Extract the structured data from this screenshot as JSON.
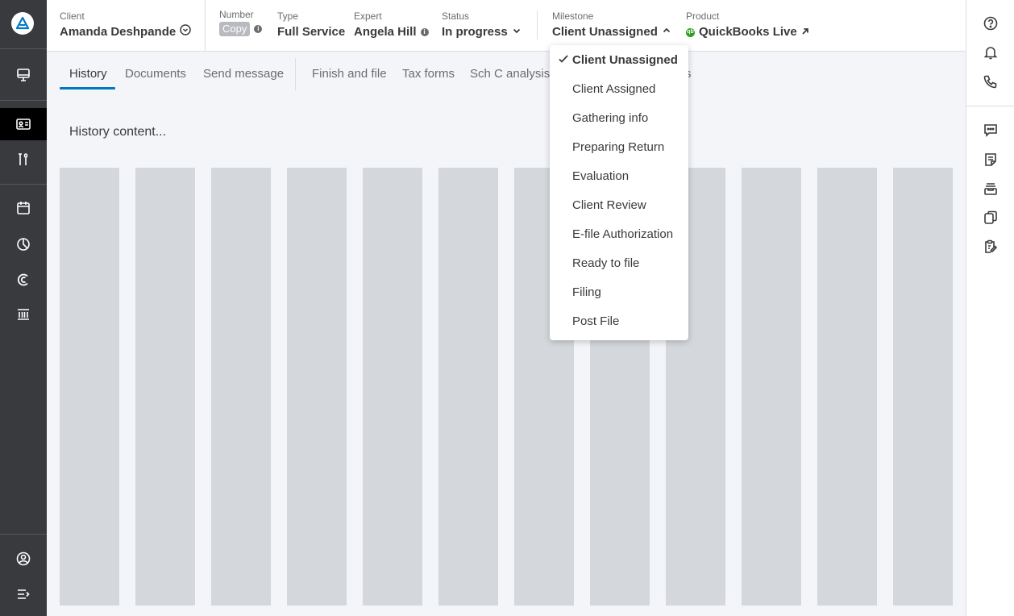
{
  "header": {
    "client": {
      "label": "Client",
      "value": "Amanda Deshpande"
    },
    "number": {
      "label": "Number",
      "copy_label": "Copy"
    },
    "type": {
      "label": "Type",
      "value": "Full Service"
    },
    "expert": {
      "label": "Expert",
      "value": "Angela Hill"
    },
    "status": {
      "label": "Status",
      "value": "In progress"
    },
    "milestone": {
      "label": "Milestone",
      "value": "Client Unassigned"
    },
    "product": {
      "label": "Product",
      "value": "QuickBooks Live"
    }
  },
  "tabs": [
    {
      "label": "History"
    },
    {
      "label": "Documents"
    },
    {
      "label": "Send message"
    },
    {
      "label": "Finish and file"
    },
    {
      "label": "Tax forms"
    },
    {
      "label": "Sch C analysis"
    },
    {
      "label": "s"
    }
  ],
  "main": {
    "content_text": "History content..."
  },
  "milestone_menu": {
    "items": [
      {
        "label": "Client Unassigned",
        "selected": true
      },
      {
        "label": "Client Assigned"
      },
      {
        "label": "Gathering info"
      },
      {
        "label": "Preparing Return"
      },
      {
        "label": "Evaluation"
      },
      {
        "label": "Client Review"
      },
      {
        "label": "E-file Authorization"
      },
      {
        "label": "Ready to file"
      },
      {
        "label": "Filing"
      },
      {
        "label": "Post File"
      }
    ]
  },
  "left_nav": {
    "icons": [
      "logo-icon",
      "monitor-icon",
      "id-card-icon",
      "tools-icon",
      "calendar-icon",
      "pie-chart-icon",
      "copyright-icon",
      "bank-icon",
      "user-circle-icon",
      "expand-menu-icon"
    ]
  },
  "right_nav": {
    "icons": [
      "help-icon",
      "bell-icon",
      "phone-icon",
      "chat-icon",
      "notes-icon",
      "inbox-icon",
      "documents-icon",
      "clipboard-edit-icon"
    ]
  },
  "colors": {
    "sidebar": "#393a3d",
    "accent": "#0077c5",
    "qb_green": "#2ca01c",
    "skeleton": "#d4d7dc"
  }
}
